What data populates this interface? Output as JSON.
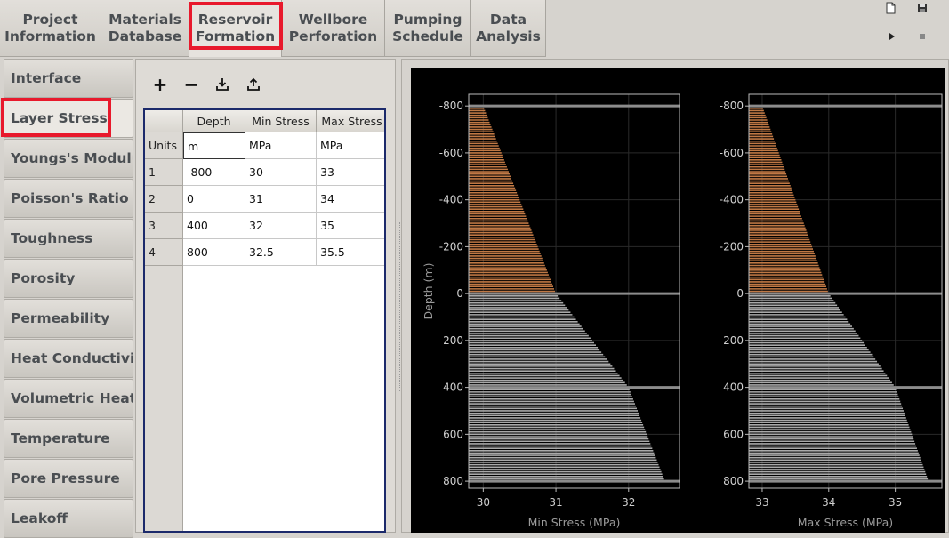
{
  "top_tabs": [
    {
      "label": "Project\nInformation"
    },
    {
      "label": "Materials\nDatabase"
    },
    {
      "label": "Reservoir\nFormation"
    },
    {
      "label": "Wellbore\nPerforation"
    },
    {
      "label": "Pumping\nSchedule"
    },
    {
      "label": "Data\nAnalysis"
    }
  ],
  "sidebar": {
    "items": [
      {
        "label": "Interface"
      },
      {
        "label": "Layer Stress"
      },
      {
        "label": "Youngs's Modulus"
      },
      {
        "label": "Poisson's Ratio"
      },
      {
        "label": "Toughness"
      },
      {
        "label": "Porosity"
      },
      {
        "label": "Permeability"
      },
      {
        "label": "Heat Conductivity"
      },
      {
        "label": "Volumetric Heat C"
      },
      {
        "label": "Temperature"
      },
      {
        "label": "Pore Pressure"
      },
      {
        "label": "Leakoff"
      }
    ]
  },
  "toolbar": {
    "add": "+",
    "remove": "−"
  },
  "table": {
    "headers": [
      "Depth",
      "Min Stress",
      "Max Stress"
    ],
    "units_label": "Units",
    "units": [
      "m",
      "MPa",
      "MPa"
    ],
    "rows": [
      {
        "num": "1",
        "cells": [
          "-800",
          "30",
          "33"
        ]
      },
      {
        "num": "2",
        "cells": [
          "0",
          "31",
          "34"
        ]
      },
      {
        "num": "3",
        "cells": [
          "400",
          "32",
          "35"
        ]
      },
      {
        "num": "4",
        "cells": [
          "800",
          "32.5",
          "35.5"
        ]
      }
    ]
  },
  "colors": {
    "upper_fill": "#c07844",
    "lower_fill": "#a9a9a9",
    "highlight": "#e8192c"
  },
  "chart_data": [
    {
      "type": "area",
      "xlabel": "Min Stress (MPa)",
      "ylabel": "Depth (m)",
      "xlim": [
        29.8,
        32.7
      ],
      "ylim": [
        -850,
        830
      ],
      "xticks": [
        30,
        31,
        32
      ],
      "yticks": [
        -800,
        -600,
        -400,
        -200,
        0,
        200,
        400,
        600,
        800
      ],
      "depth": [
        -800,
        0,
        400,
        800
      ],
      "values": [
        30,
        31,
        32,
        32.5
      ]
    },
    {
      "type": "area",
      "xlabel": "Max Stress (MPa)",
      "ylabel": "",
      "xlim": [
        32.8,
        35.7
      ],
      "ylim": [
        -850,
        830
      ],
      "xticks": [
        33,
        34,
        35
      ],
      "yticks": [
        -800,
        -600,
        -400,
        -200,
        0,
        200,
        400,
        600,
        800
      ],
      "depth": [
        -800,
        0,
        400,
        800
      ],
      "values": [
        33,
        34,
        35,
        35.5
      ]
    }
  ]
}
